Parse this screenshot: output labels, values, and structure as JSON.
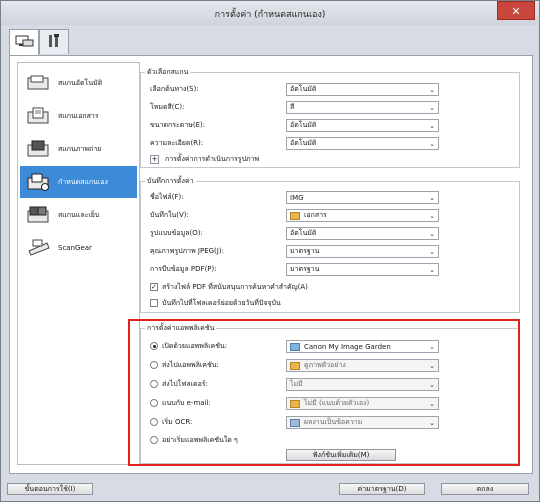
{
  "window": {
    "title": "การตั้งค่า (กำหนดสแกนเอง)",
    "close": "✕"
  },
  "tabs": [
    {
      "name": "scan-tab"
    },
    {
      "name": "general-settings-tab"
    }
  ],
  "sidebar": {
    "items": [
      {
        "label": "สแกนอัตโนมัติ"
      },
      {
        "label": "สแกนเอกสาร"
      },
      {
        "label": "สแกนภาพถ่าย"
      },
      {
        "label": "กำหนดสแกนเอง"
      },
      {
        "label": "สแกนและเย็บ"
      },
      {
        "label": "ScanGear"
      }
    ],
    "active_index": 3
  },
  "scan_options": {
    "title": "ตัวเลือกสแกน",
    "rows": [
      {
        "label": "เลือกต้นทาง(S):",
        "value": "อัตโนมัติ"
      },
      {
        "label": "โหมดสี(C):",
        "value": "สี"
      },
      {
        "label": "ขนาดกระดาษ(E):",
        "value": "อัตโนมัติ"
      },
      {
        "label": "ความละเอียด(R):",
        "value": "อัตโนมัติ"
      }
    ],
    "image_processing_label": "การตั้งค่าการดำเนินการรูปภาพ"
  },
  "save_settings": {
    "title": "บันทึกการตั้งค่า",
    "rows": [
      {
        "label": "ชื่อไฟล์(F):",
        "value": "IMG"
      },
      {
        "label": "บันทึกใน(V):",
        "value": "เอกสาร"
      },
      {
        "label": "รูปแบบข้อมูล(O):",
        "value": "อัตโนมัติ"
      },
      {
        "label": "คุณภาพรูปภาพ JPEG(J):",
        "value": "มาตรฐาน"
      },
      {
        "label": "การบีบข้อมูล PDF(P):",
        "value": "มาตรฐาน"
      }
    ],
    "checkbox1": {
      "label": "สร้างไฟล์ PDF ที่สนับสนุนการค้นหาคำสำคัญ(A)",
      "checked": true
    },
    "checkbox2": {
      "label": "บันทึกไปที่โฟลเดอร์ย่อยด้วยวันที่ปัจจุบัน",
      "checked": false
    }
  },
  "app_settings": {
    "title": "การตั้งค่าแอพพลิเคชัน",
    "rows": [
      {
        "label": "เปิดด้วยแอพพลิเคชัน:",
        "value": "Canon My Image Garden",
        "selected": true,
        "disabled": false
      },
      {
        "label": "ส่งไปแอพพลิเคชัน:",
        "value": "ดูภาพตัวอย่าง",
        "selected": false,
        "disabled": true
      },
      {
        "label": "ส่งไปโฟลเดอร์:",
        "value": "ไม่มี",
        "selected": false,
        "disabled": true
      },
      {
        "label": "แนบกับ e-mail:",
        "value": "ไม่มี (แนบด้วยตัวเอง)",
        "selected": false,
        "disabled": true
      },
      {
        "label": "เริ่ม OCR:",
        "value": "ผลงานเป็นข้อความ",
        "selected": false,
        "disabled": true
      },
      {
        "label": "อย่าเริ่มแอพพลิเคชันใด ๆ",
        "value": "",
        "selected": false,
        "disabled": false
      }
    ],
    "more_functions_button": "ฟังก์ชันเพิ่มเติม(M)"
  },
  "footer": {
    "instructions_button": "ขั้นตอนการใช้(I)",
    "defaults_button": "ค่ามาตรฐาน(D)",
    "ok_button": "ตกลง"
  },
  "colors": {
    "accent": "#3c8ad8",
    "highlight_border": "#e0221c"
  }
}
